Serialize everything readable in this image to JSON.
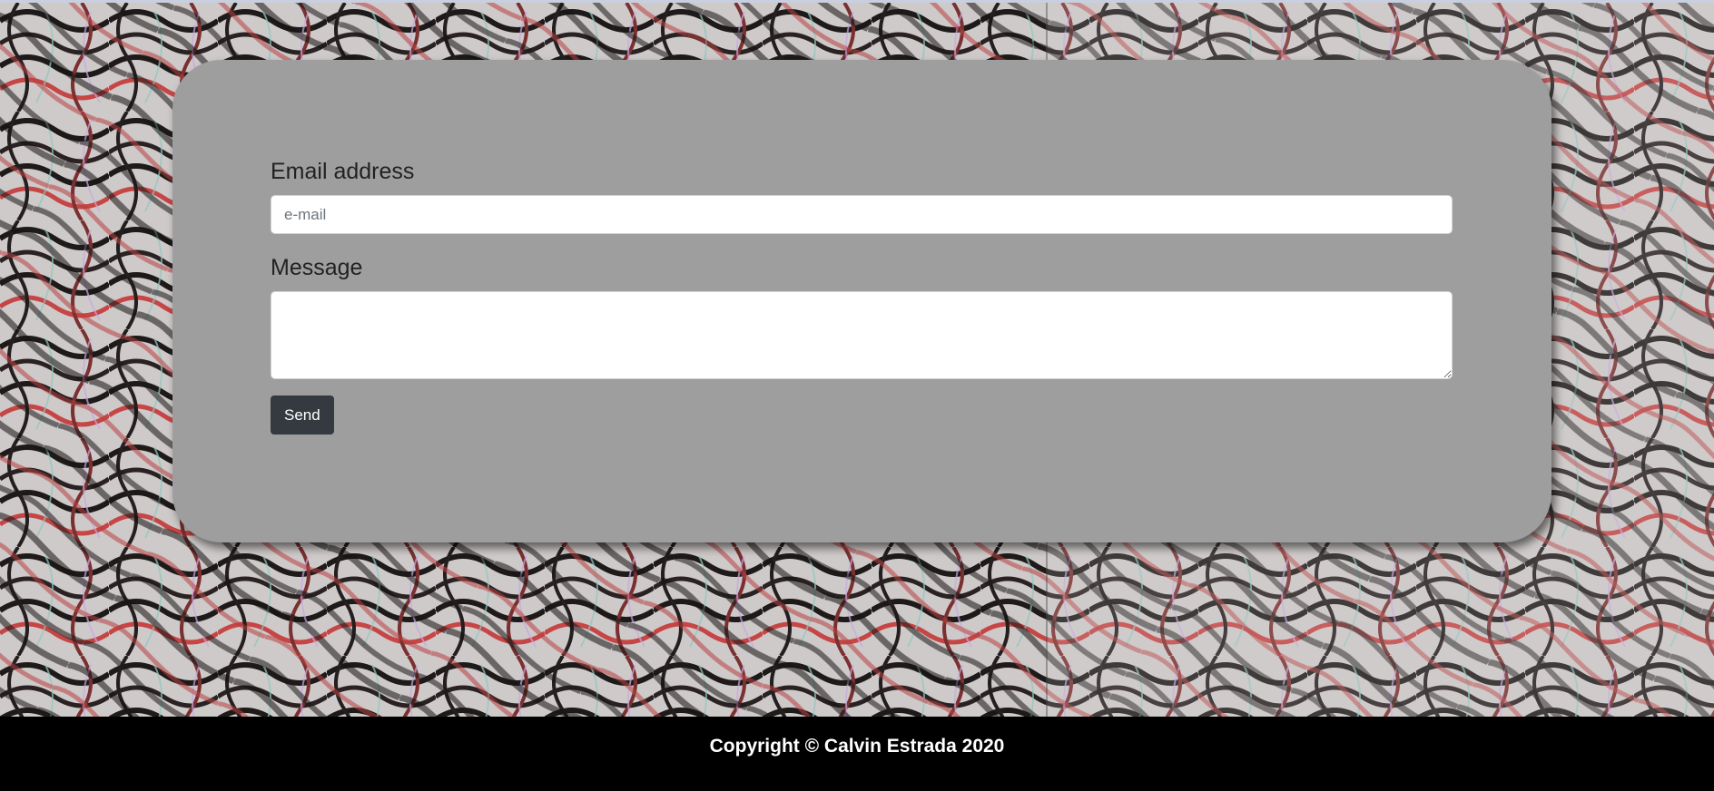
{
  "form": {
    "email_label": "Email address",
    "email_placeholder": "e-mail",
    "email_value": "",
    "message_label": "Message",
    "message_value": "",
    "send_label": "Send"
  },
  "footer": {
    "copyright": "Copyright © Calvin Estrada 2020"
  },
  "colors": {
    "card_bg": "#9e9e9e",
    "button_bg": "#343a40",
    "footer_bg": "#000000"
  }
}
